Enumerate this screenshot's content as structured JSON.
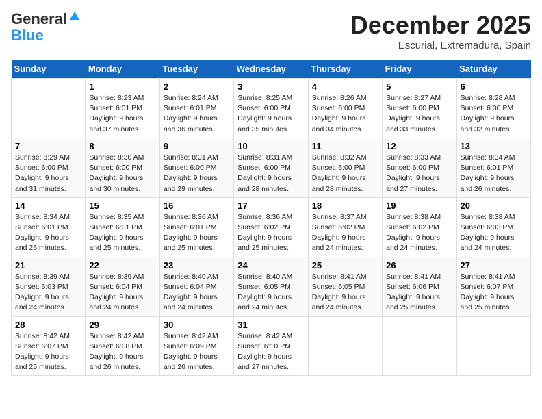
{
  "header": {
    "logo_general": "General",
    "logo_blue": "Blue",
    "month": "December 2025",
    "location": "Escurial, Extremadura, Spain"
  },
  "calendar": {
    "days_of_week": [
      "Sunday",
      "Monday",
      "Tuesday",
      "Wednesday",
      "Thursday",
      "Friday",
      "Saturday"
    ],
    "weeks": [
      [
        {
          "day": "",
          "info": ""
        },
        {
          "day": "1",
          "info": "Sunrise: 8:23 AM\nSunset: 6:01 PM\nDaylight: 9 hours\nand 37 minutes."
        },
        {
          "day": "2",
          "info": "Sunrise: 8:24 AM\nSunset: 6:01 PM\nDaylight: 9 hours\nand 36 minutes."
        },
        {
          "day": "3",
          "info": "Sunrise: 8:25 AM\nSunset: 6:00 PM\nDaylight: 9 hours\nand 35 minutes."
        },
        {
          "day": "4",
          "info": "Sunrise: 8:26 AM\nSunset: 6:00 PM\nDaylight: 9 hours\nand 34 minutes."
        },
        {
          "day": "5",
          "info": "Sunrise: 8:27 AM\nSunset: 6:00 PM\nDaylight: 9 hours\nand 33 minutes."
        },
        {
          "day": "6",
          "info": "Sunrise: 8:28 AM\nSunset: 6:00 PM\nDaylight: 9 hours\nand 32 minutes."
        }
      ],
      [
        {
          "day": "7",
          "info": "Sunrise: 8:29 AM\nSunset: 6:00 PM\nDaylight: 9 hours\nand 31 minutes."
        },
        {
          "day": "8",
          "info": "Sunrise: 8:30 AM\nSunset: 6:00 PM\nDaylight: 9 hours\nand 30 minutes."
        },
        {
          "day": "9",
          "info": "Sunrise: 8:31 AM\nSunset: 6:00 PM\nDaylight: 9 hours\nand 29 minutes."
        },
        {
          "day": "10",
          "info": "Sunrise: 8:31 AM\nSunset: 6:00 PM\nDaylight: 9 hours\nand 28 minutes."
        },
        {
          "day": "11",
          "info": "Sunrise: 8:32 AM\nSunset: 6:00 PM\nDaylight: 9 hours\nand 28 minutes."
        },
        {
          "day": "12",
          "info": "Sunrise: 8:33 AM\nSunset: 6:00 PM\nDaylight: 9 hours\nand 27 minutes."
        },
        {
          "day": "13",
          "info": "Sunrise: 8:34 AM\nSunset: 6:01 PM\nDaylight: 9 hours\nand 26 minutes."
        }
      ],
      [
        {
          "day": "14",
          "info": "Sunrise: 8:34 AM\nSunset: 6:01 PM\nDaylight: 9 hours\nand 26 minutes."
        },
        {
          "day": "15",
          "info": "Sunrise: 8:35 AM\nSunset: 6:01 PM\nDaylight: 9 hours\nand 25 minutes."
        },
        {
          "day": "16",
          "info": "Sunrise: 8:36 AM\nSunset: 6:01 PM\nDaylight: 9 hours\nand 25 minutes."
        },
        {
          "day": "17",
          "info": "Sunrise: 8:36 AM\nSunset: 6:02 PM\nDaylight: 9 hours\nand 25 minutes."
        },
        {
          "day": "18",
          "info": "Sunrise: 8:37 AM\nSunset: 6:02 PM\nDaylight: 9 hours\nand 24 minutes."
        },
        {
          "day": "19",
          "info": "Sunrise: 8:38 AM\nSunset: 6:02 PM\nDaylight: 9 hours\nand 24 minutes."
        },
        {
          "day": "20",
          "info": "Sunrise: 8:38 AM\nSunset: 6:03 PM\nDaylight: 9 hours\nand 24 minutes."
        }
      ],
      [
        {
          "day": "21",
          "info": "Sunrise: 8:39 AM\nSunset: 6:03 PM\nDaylight: 9 hours\nand 24 minutes."
        },
        {
          "day": "22",
          "info": "Sunrise: 8:39 AM\nSunset: 6:04 PM\nDaylight: 9 hours\nand 24 minutes."
        },
        {
          "day": "23",
          "info": "Sunrise: 8:40 AM\nSunset: 6:04 PM\nDaylight: 9 hours\nand 24 minutes."
        },
        {
          "day": "24",
          "info": "Sunrise: 8:40 AM\nSunset: 6:05 PM\nDaylight: 9 hours\nand 24 minutes."
        },
        {
          "day": "25",
          "info": "Sunrise: 8:41 AM\nSunset: 6:05 PM\nDaylight: 9 hours\nand 24 minutes."
        },
        {
          "day": "26",
          "info": "Sunrise: 8:41 AM\nSunset: 6:06 PM\nDaylight: 9 hours\nand 25 minutes."
        },
        {
          "day": "27",
          "info": "Sunrise: 8:41 AM\nSunset: 6:07 PM\nDaylight: 9 hours\nand 25 minutes."
        }
      ],
      [
        {
          "day": "28",
          "info": "Sunrise: 8:42 AM\nSunset: 6:07 PM\nDaylight: 9 hours\nand 25 minutes."
        },
        {
          "day": "29",
          "info": "Sunrise: 8:42 AM\nSunset: 6:08 PM\nDaylight: 9 hours\nand 26 minutes."
        },
        {
          "day": "30",
          "info": "Sunrise: 8:42 AM\nSunset: 6:09 PM\nDaylight: 9 hours\nand 26 minutes."
        },
        {
          "day": "31",
          "info": "Sunrise: 8:42 AM\nSunset: 6:10 PM\nDaylight: 9 hours\nand 27 minutes."
        },
        {
          "day": "",
          "info": ""
        },
        {
          "day": "",
          "info": ""
        },
        {
          "day": "",
          "info": ""
        }
      ]
    ]
  }
}
